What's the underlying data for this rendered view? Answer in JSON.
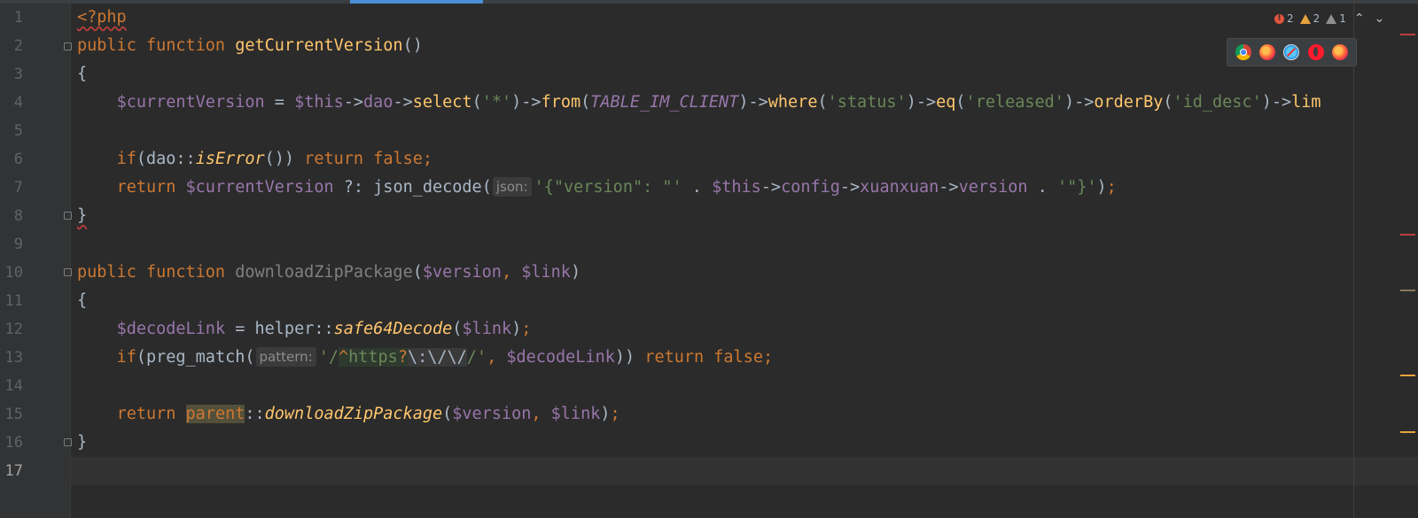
{
  "editor": {
    "line_numbers": [
      "1",
      "2",
      "3",
      "4",
      "5",
      "6",
      "7",
      "8",
      "9",
      "10",
      "11",
      "12",
      "13",
      "14",
      "15",
      "16",
      "17"
    ],
    "active_line": "17"
  },
  "inspections": {
    "errors": "2",
    "warnings": "2",
    "weak_warnings": "1"
  },
  "browsers": [
    "chrome-icon",
    "firefox-icon",
    "safari-icon",
    "opera-icon",
    "firefox-icon"
  ],
  "code": {
    "l1": {
      "open_tag": "<?php"
    },
    "l2": {
      "kw_public": "public",
      "kw_function": "function",
      "name": "getCurrentVersion",
      "parens": "()"
    },
    "l3": {
      "brace": "{"
    },
    "l4": {
      "var": "$currentVersion",
      "eq": " = ",
      "this": "$this",
      "arrow1": "->",
      "dao": "dao",
      "arrow2": "->",
      "select": "select",
      "p1": "(",
      "s1": "'*'",
      "p2": ")->",
      "from": "from",
      "p3": "(",
      "const": "TABLE_IM_CLIENT",
      "p4": ")->",
      "where": "where",
      "p5": "(",
      "s2": "'status'",
      "p6": ")->",
      "eqm": "eq",
      "p7": "(",
      "s3": "'released'",
      "p8": ")->",
      "orderBy": "orderBy",
      "p9": "(",
      "s4": "'id_desc'",
      "p10": ")->",
      "lim": "lim"
    },
    "l6": {
      "if": "if",
      "p1": "(",
      "cls": "dao",
      "dc": "::",
      "method": "isError",
      "p2": "()) ",
      "ret": "return",
      "sp": " ",
      "false": "false",
      "semi": ";"
    },
    "l7": {
      "ret": "return",
      "sp": " ",
      "var": "$currentVersion",
      "op": " ?: ",
      "fn": "json_decode",
      "p1": "(",
      "hint": "json:",
      "s1": "'{\"version\": \"'",
      "dot1": " . ",
      "this": "$this",
      "a1": "->",
      "config": "config",
      "a2": "->",
      "xuan": "xuanxuan",
      "a3": "->",
      "version": "version",
      "dot2": " . ",
      "s2": "'\"}'",
      "p2": ")",
      "semi": ";"
    },
    "l8": {
      "brace": "}"
    },
    "l10": {
      "kw_public": "public",
      "kw_function": "function",
      "name": "downloadZipPackage",
      "p1": "(",
      "v1": "$version",
      "comma": ", ",
      "v2": "$link",
      "p2": ")"
    },
    "l11": {
      "brace": "{"
    },
    "l12": {
      "var": "$decodeLink",
      "eq": " = ",
      "cls": "helper",
      "dc": "::",
      "method": "safe64Decode",
      "p1": "(",
      "arg": "$link",
      "p2": ")",
      "semi": ";"
    },
    "l13": {
      "if": "if",
      "p1": "(",
      "fn": "preg_match",
      "p2": "(",
      "hint": "pattern:",
      "q1": "'/",
      "caret": "^",
      "https": "https",
      "q": "?",
      "e1": "\\:",
      "e2": "\\/",
      "e3": "\\/",
      "q2": "/'",
      "comma": ", ",
      "var": "$decodeLink",
      "p3": ")) ",
      "ret": "return",
      "sp": " ",
      "false": "false",
      "semi": ";"
    },
    "l15": {
      "ret": "return",
      "sp": " ",
      "parent": "parent",
      "dc": "::",
      "method": "downloadZipPackage",
      "p1": "(",
      "v1": "$version",
      "comma": ", ",
      "v2": "$link",
      "p2": ")",
      "semi": ";"
    },
    "l16": {
      "brace": "}"
    }
  },
  "colors": {
    "background": "#2b2b2b",
    "keyword": "#cc7832",
    "function": "#ffc66d",
    "variable": "#9876aa",
    "string": "#6a8759",
    "text": "#a9b7c6",
    "error_mark": "#bc3f3c",
    "warning_mark": "#e8a33d"
  }
}
